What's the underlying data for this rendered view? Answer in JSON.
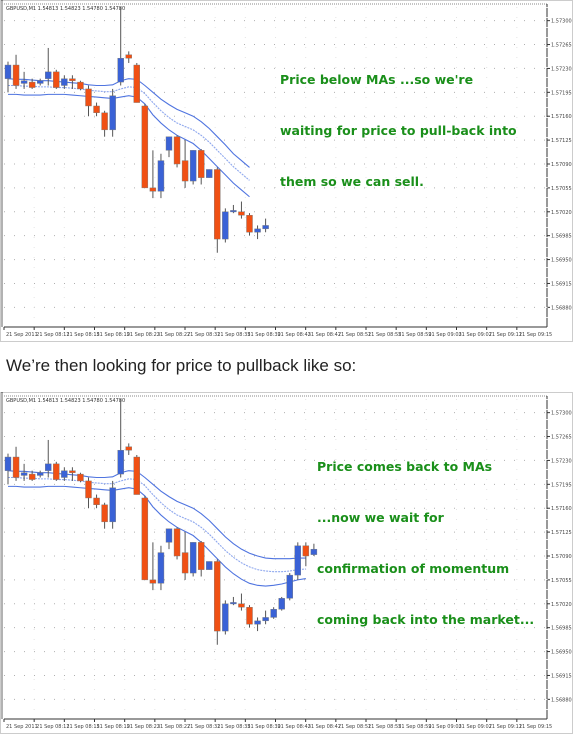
{
  "caption": "We’re then looking for price to pullback like so:",
  "colors": {
    "bull": "#3a62d6",
    "bear": "#f05014",
    "ma": "#4f74e0",
    "ma_mid": "#8fa8ee",
    "note": "#1a8f1a",
    "grid": "#b0b0b0"
  },
  "chart_data": [
    {
      "type": "candlestick",
      "header": "GBPUSD,M1  1.54813 1.54823 1.54780 1.54780",
      "annotation": [
        "Price below MAs ...so we're",
        "waiting for price to pull-back into",
        "them so we can sell."
      ],
      "y_ticks": [
        "1.57300",
        "1.57265",
        "1.57230",
        "1.57195",
        "1.57160",
        "1.57125",
        "1.57090",
        "1.57055",
        "1.57020",
        "1.56985",
        "1.56950",
        "1.56915",
        "1.56880"
      ],
      "x_ticks": [
        "21 Sep 2011",
        "21 Sep 08:11",
        "21 Sep 08:15",
        "21 Sep 08:19",
        "21 Sep 08:23",
        "21 Sep 08:27",
        "21 Sep 08:31",
        "21 Sep 08:35",
        "21 Sep 08:39",
        "21 Sep 08:43",
        "21 Sep 08:47",
        "21 Sep 08:51",
        "21 Sep 08:55",
        "21 Sep 08:59",
        "21 Sep 09:03",
        "21 Sep 09:07",
        "21 Sep 09:11",
        "21 Sep 09:15"
      ],
      "ylim": [
        1.5686,
        1.5732
      ],
      "candles": [
        [
          1.57215,
          1.5724,
          1.57195,
          1.57235
        ],
        [
          1.57235,
          1.5725,
          1.572,
          1.57205
        ],
        [
          1.57208,
          1.57225,
          1.572,
          1.57212
        ],
        [
          1.5721,
          1.57215,
          1.572,
          1.57202
        ],
        [
          1.57208,
          1.57215,
          1.57205,
          1.57212
        ],
        [
          1.57215,
          1.5726,
          1.57205,
          1.57225
        ],
        [
          1.57225,
          1.57228,
          1.572,
          1.57202
        ],
        [
          1.57205,
          1.5722,
          1.572,
          1.57215
        ],
        [
          1.57215,
          1.5722,
          1.572,
          1.57212
        ],
        [
          1.5721,
          1.57212,
          1.57198,
          1.572
        ],
        [
          1.572,
          1.57205,
          1.5716,
          1.57175
        ],
        [
          1.57175,
          1.5718,
          1.5716,
          1.57165
        ],
        [
          1.57165,
          1.57168,
          1.5713,
          1.5714
        ],
        [
          1.5714,
          1.572,
          1.5713,
          1.5719
        ],
        [
          1.5721,
          1.5732,
          1.57205,
          1.57245
        ],
        [
          1.5725,
          1.57255,
          1.57238,
          1.57245
        ],
        [
          1.57235,
          1.57238,
          1.5718,
          1.5718
        ],
        [
          1.57175,
          1.57178,
          1.57055,
          1.57055
        ],
        [
          1.57055,
          1.5711,
          1.5704,
          1.5705
        ],
        [
          1.5705,
          1.57105,
          1.5704,
          1.57095
        ],
        [
          1.5711,
          1.5713,
          1.571,
          1.5713
        ],
        [
          1.5713,
          1.57132,
          1.57085,
          1.5709
        ],
        [
          1.57095,
          1.57125,
          1.57055,
          1.57065
        ],
        [
          1.57065,
          1.5711,
          1.5706,
          1.5711
        ],
        [
          1.5711,
          1.57112,
          1.5706,
          1.5707
        ],
        [
          1.5707,
          1.57082,
          1.5707,
          1.57082
        ],
        [
          1.57082,
          1.57085,
          1.5696,
          1.5698
        ],
        [
          1.5698,
          1.57025,
          1.56975,
          1.5702
        ],
        [
          1.5702,
          1.5703,
          1.57018,
          1.57022
        ],
        [
          1.5702,
          1.57035,
          1.5701,
          1.57015
        ],
        [
          1.57015,
          1.57018,
          1.56985,
          1.5699
        ],
        [
          1.5699,
          1.57,
          1.5698,
          1.56995
        ],
        [
          1.56995,
          1.5701,
          1.5699,
          1.57
        ]
      ],
      "ma_upper": [
        1.57215,
        1.57214,
        1.57214,
        1.57213,
        1.57212,
        1.57212,
        1.57211,
        1.5721,
        1.57209,
        1.57208,
        1.57206,
        1.57205,
        1.57205,
        1.57206,
        1.57212,
        1.57215,
        1.57214,
        1.57205,
        1.57195,
        1.57185,
        1.57177,
        1.5717,
        1.57165,
        1.5716,
        1.57152,
        1.57142,
        1.5713,
        1.57118,
        1.57105,
        1.57095,
        1.57085
      ],
      "ma_mid": [
        1.57205,
        1.57205,
        1.57204,
        1.57204,
        1.57203,
        1.57203,
        1.57202,
        1.57202,
        1.57201,
        1.572,
        1.57198,
        1.57197,
        1.57196,
        1.57196,
        1.572,
        1.57203,
        1.57202,
        1.57193,
        1.5718,
        1.57168,
        1.57158,
        1.5715,
        1.57145,
        1.5714,
        1.57132,
        1.57122,
        1.5711,
        1.57098,
        1.57086,
        1.57076,
        1.57066
      ],
      "ma_lower": [
        1.57192,
        1.57192,
        1.57191,
        1.57191,
        1.57191,
        1.57192,
        1.57192,
        1.57192,
        1.57191,
        1.5719,
        1.57189,
        1.57188,
        1.57187,
        1.57186,
        1.57188,
        1.5719,
        1.57188,
        1.57178,
        1.57162,
        1.5715,
        1.5714,
        1.57132,
        1.57126,
        1.5712,
        1.5711,
        1.57098,
        1.57086,
        1.57074,
        1.57062,
        1.57052,
        1.57042
      ]
    },
    {
      "type": "candlestick",
      "header": "GBPUSD,M1  1.54813 1.54823 1.54780 1.54780",
      "annotation": [
        "Price comes back to MAs",
        "...now we wait for",
        "confirmation of momentum",
        "coming back into the market..."
      ],
      "y_ticks": [
        "1.57300",
        "1.57265",
        "1.57230",
        "1.57195",
        "1.57160",
        "1.57125",
        "1.57090",
        "1.57055",
        "1.57020",
        "1.56985",
        "1.56950",
        "1.56915",
        "1.56880"
      ],
      "x_ticks": [
        "21 Sep 2011",
        "21 Sep 08:11",
        "21 Sep 08:15",
        "21 Sep 08:19",
        "21 Sep 08:23",
        "21 Sep 08:27",
        "21 Sep 08:31",
        "21 Sep 08:35",
        "21 Sep 08:39",
        "21 Sep 08:43",
        "21 Sep 08:47",
        "21 Sep 08:51",
        "21 Sep 08:55",
        "21 Sep 08:59",
        "21 Sep 09:03",
        "21 Sep 09:07",
        "21 Sep 09:11",
        "21 Sep 09:15"
      ],
      "ylim": [
        1.5686,
        1.5732
      ],
      "candles": [
        [
          1.57215,
          1.5724,
          1.57195,
          1.57235
        ],
        [
          1.57235,
          1.5725,
          1.572,
          1.57205
        ],
        [
          1.57208,
          1.57225,
          1.572,
          1.57212
        ],
        [
          1.5721,
          1.57215,
          1.572,
          1.57202
        ],
        [
          1.57208,
          1.57215,
          1.57205,
          1.57212
        ],
        [
          1.57215,
          1.5726,
          1.57205,
          1.57225
        ],
        [
          1.57225,
          1.57228,
          1.572,
          1.57202
        ],
        [
          1.57205,
          1.5722,
          1.572,
          1.57215
        ],
        [
          1.57215,
          1.5722,
          1.572,
          1.57212
        ],
        [
          1.5721,
          1.57212,
          1.57198,
          1.572
        ],
        [
          1.572,
          1.57205,
          1.5716,
          1.57175
        ],
        [
          1.57175,
          1.5718,
          1.5716,
          1.57165
        ],
        [
          1.57165,
          1.57168,
          1.5713,
          1.5714
        ],
        [
          1.5714,
          1.572,
          1.5713,
          1.5719
        ],
        [
          1.5721,
          1.5732,
          1.57205,
          1.57245
        ],
        [
          1.5725,
          1.57255,
          1.57238,
          1.57245
        ],
        [
          1.57235,
          1.57238,
          1.5718,
          1.5718
        ],
        [
          1.57175,
          1.57178,
          1.57055,
          1.57055
        ],
        [
          1.57055,
          1.5711,
          1.5704,
          1.5705
        ],
        [
          1.5705,
          1.57105,
          1.5704,
          1.57095
        ],
        [
          1.5711,
          1.5713,
          1.571,
          1.5713
        ],
        [
          1.5713,
          1.57132,
          1.57085,
          1.5709
        ],
        [
          1.57095,
          1.57125,
          1.57055,
          1.57065
        ],
        [
          1.57065,
          1.5711,
          1.5706,
          1.5711
        ],
        [
          1.5711,
          1.57112,
          1.5706,
          1.5707
        ],
        [
          1.5707,
          1.57082,
          1.5707,
          1.57082
        ],
        [
          1.57082,
          1.57085,
          1.5696,
          1.5698
        ],
        [
          1.5698,
          1.57025,
          1.56975,
          1.5702
        ],
        [
          1.5702,
          1.5703,
          1.57018,
          1.57022
        ],
        [
          1.5702,
          1.57035,
          1.5701,
          1.57015
        ],
        [
          1.57015,
          1.57018,
          1.56985,
          1.5699
        ],
        [
          1.5699,
          1.57,
          1.5698,
          1.56995
        ],
        [
          1.56995,
          1.5701,
          1.5699,
          1.57
        ],
        [
          1.57,
          1.57015,
          1.56998,
          1.57012
        ],
        [
          1.57012,
          1.5703,
          1.5701,
          1.57028
        ],
        [
          1.57028,
          1.57065,
          1.57025,
          1.57062
        ],
        [
          1.57062,
          1.5711,
          1.57055,
          1.57105
        ],
        [
          1.57105,
          1.5711,
          1.57075,
          1.5709
        ],
        [
          1.57092,
          1.57108,
          1.5709,
          1.571
        ]
      ],
      "ma_upper": [
        1.57215,
        1.57214,
        1.57214,
        1.57213,
        1.57212,
        1.57212,
        1.57211,
        1.5721,
        1.57209,
        1.57208,
        1.57206,
        1.57205,
        1.57205,
        1.57206,
        1.57212,
        1.57215,
        1.57214,
        1.57205,
        1.57195,
        1.57185,
        1.57177,
        1.5717,
        1.57165,
        1.5716,
        1.57152,
        1.57142,
        1.5713,
        1.57118,
        1.57108,
        1.571,
        1.57094,
        1.5709,
        1.57087,
        1.57086,
        1.57086,
        1.57086,
        1.57087,
        1.57087
      ],
      "ma_mid": [
        1.57205,
        1.57205,
        1.57204,
        1.57204,
        1.57203,
        1.57203,
        1.57202,
        1.57202,
        1.57201,
        1.572,
        1.57198,
        1.57197,
        1.57196,
        1.57196,
        1.572,
        1.57203,
        1.57202,
        1.57193,
        1.5718,
        1.57168,
        1.57158,
        1.5715,
        1.57145,
        1.5714,
        1.57132,
        1.57122,
        1.5711,
        1.57098,
        1.57088,
        1.5708,
        1.57074,
        1.5707,
        1.57068,
        1.57067,
        1.57067,
        1.57068,
        1.5707,
        1.57071
      ],
      "ma_lower": [
        1.57192,
        1.57192,
        1.57191,
        1.57191,
        1.57191,
        1.57192,
        1.57192,
        1.57192,
        1.57191,
        1.5719,
        1.57189,
        1.57188,
        1.57187,
        1.57186,
        1.57188,
        1.5719,
        1.57188,
        1.57178,
        1.57162,
        1.5715,
        1.5714,
        1.57132,
        1.57126,
        1.5712,
        1.5711,
        1.57098,
        1.57086,
        1.57074,
        1.57064,
        1.57056,
        1.5705,
        1.57047,
        1.57046,
        1.57047,
        1.57049,
        1.57052,
        1.57055,
        1.57057
      ]
    }
  ]
}
